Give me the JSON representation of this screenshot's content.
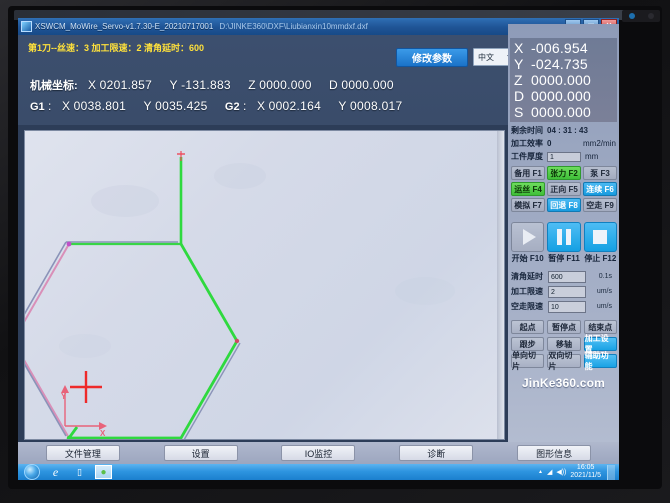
{
  "window": {
    "title": "XSWCM_MoWire_Servo-v1.7.30-E_20210717001",
    "file_path": "D:\\JINKE360\\DXF\\Liubianxin10mmdxf.dxf",
    "minimize": "–",
    "maximize": "□",
    "close": "✕",
    "app_icon": "app-window-icon"
  },
  "header": {
    "cut_info": "第1刀--丝速：3 加工限速：2 清角延时：600",
    "modify_params_button": "修改参数",
    "language": "中文",
    "machine_coord": {
      "label": "机械坐标:",
      "x_label": "X",
      "x": "0201.857",
      "y_label": "Y",
      "y": "-131.883",
      "z_label": "Z",
      "z": "0000.000",
      "d_label": "D",
      "d": "0000.000"
    },
    "work_coord": {
      "g1_label": "G1",
      "g1_sep": ":",
      "g1_x_label": "X",
      "g1_x": "0038.801",
      "g1_y_label": "Y",
      "g1_y": "0035.425",
      "g2_label": "G2",
      "g2_sep": ":",
      "g2_x_label": "X",
      "g2_x": "0002.164",
      "g2_y_label": "Y",
      "g2_y": "0008.017"
    }
  },
  "dro": {
    "rows": [
      {
        "axis": "X",
        "value": "-006.954"
      },
      {
        "axis": "Y",
        "value": "-024.735"
      },
      {
        "axis": "Z",
        "value": "0000.000"
      },
      {
        "axis": "D",
        "value": "0000.000"
      },
      {
        "axis": "S",
        "value": "0000.000"
      }
    ]
  },
  "status": {
    "remaining_time_label": "剩余时间",
    "remaining_time": "04  :  31  :  43",
    "efficiency_label": "加工效率",
    "efficiency": "0",
    "efficiency_unit": "mm2/min",
    "thickness_label": "工件厚度",
    "thickness": "1",
    "thickness_unit": "mm"
  },
  "function_keys": [
    {
      "label": "备用 F1",
      "state": "off"
    },
    {
      "label": "张力 F2",
      "state": "green"
    },
    {
      "label": "泵 F3",
      "state": "off"
    },
    {
      "label": "运丝 F4",
      "state": "green"
    },
    {
      "label": "正向 F5",
      "state": "off"
    },
    {
      "label": "连续 F6",
      "state": "blue"
    },
    {
      "label": "模拟 F7",
      "state": "off"
    },
    {
      "label": "回退 F8",
      "state": "blue"
    },
    {
      "label": "空走 F9",
      "state": "off"
    }
  ],
  "transport": [
    {
      "icon": "play-icon",
      "label": "开始 F10",
      "state": "off"
    },
    {
      "icon": "pause-icon",
      "label": "暂停 F11",
      "state": "blue"
    },
    {
      "icon": "stop-icon",
      "label": "停止 F12",
      "state": "blue"
    }
  ],
  "params": [
    {
      "label": "清角延时",
      "value": "600",
      "unit": "0.1s"
    },
    {
      "label": "加工限速",
      "value": "2",
      "unit": "um/s"
    },
    {
      "label": "空走限速",
      "value": "10",
      "unit": "um/s"
    }
  ],
  "actions": [
    {
      "label": "起点",
      "state": "off"
    },
    {
      "label": "暂停点",
      "state": "off"
    },
    {
      "label": "结束点",
      "state": "off"
    },
    {
      "label": "跟步",
      "state": "off"
    },
    {
      "label": "移轴",
      "state": "off"
    },
    {
      "label": "加工设置",
      "state": "blue"
    },
    {
      "label": "单向切片",
      "state": "off"
    },
    {
      "label": "双向切片",
      "state": "off"
    },
    {
      "label": "辅助功能",
      "state": "blue"
    }
  ],
  "brand": "JinKe360.com",
  "bottom_buttons": [
    "文件管理",
    "设置",
    "IO监控",
    "诊断",
    "图形信息"
  ],
  "taskbar": {
    "start": "start-orb-icon",
    "items": [
      {
        "icon": "internet-explorer-icon",
        "glyph": "e",
        "active": false
      },
      {
        "icon": "folder-icon",
        "glyph": "▬",
        "active": false
      },
      {
        "icon": "wire-edm-app-icon",
        "glyph": "●",
        "active": true
      }
    ],
    "tray": {
      "arrow": "▲",
      "network": "◢",
      "volume": "◀))"
    },
    "time": "16:05",
    "date": "2021/11/5"
  },
  "canvas": {
    "axis_x_label": "X",
    "axis_y_label": "Y",
    "origin_marker": "crosshair-marker",
    "colors": {
      "part_outline": "#d98fb8",
      "toolpath": "#2fd93f",
      "guide": "#8a93b8",
      "marker": "#ee2a2a",
      "axis": "#e8637a"
    },
    "geometry": {
      "hexagon": [
        [
          188,
          225
        ],
        [
          300,
          225
        ],
        [
          356,
          322
        ],
        [
          300,
          419
        ],
        [
          188,
          419
        ],
        [
          132,
          322
        ]
      ],
      "lead_in": [
        [
          300,
          138
        ],
        [
          300,
          225
        ]
      ],
      "toolpath_green": [
        [
          300,
          225
        ],
        [
          356,
          322
        ],
        [
          300,
          419
        ],
        [
          188,
          419
        ],
        [
          196,
          408
        ]
      ],
      "marker_point": [
        205,
        371
      ],
      "node_points": [
        [
          188,
          225
        ],
        [
          132,
          322
        ]
      ]
    }
  }
}
